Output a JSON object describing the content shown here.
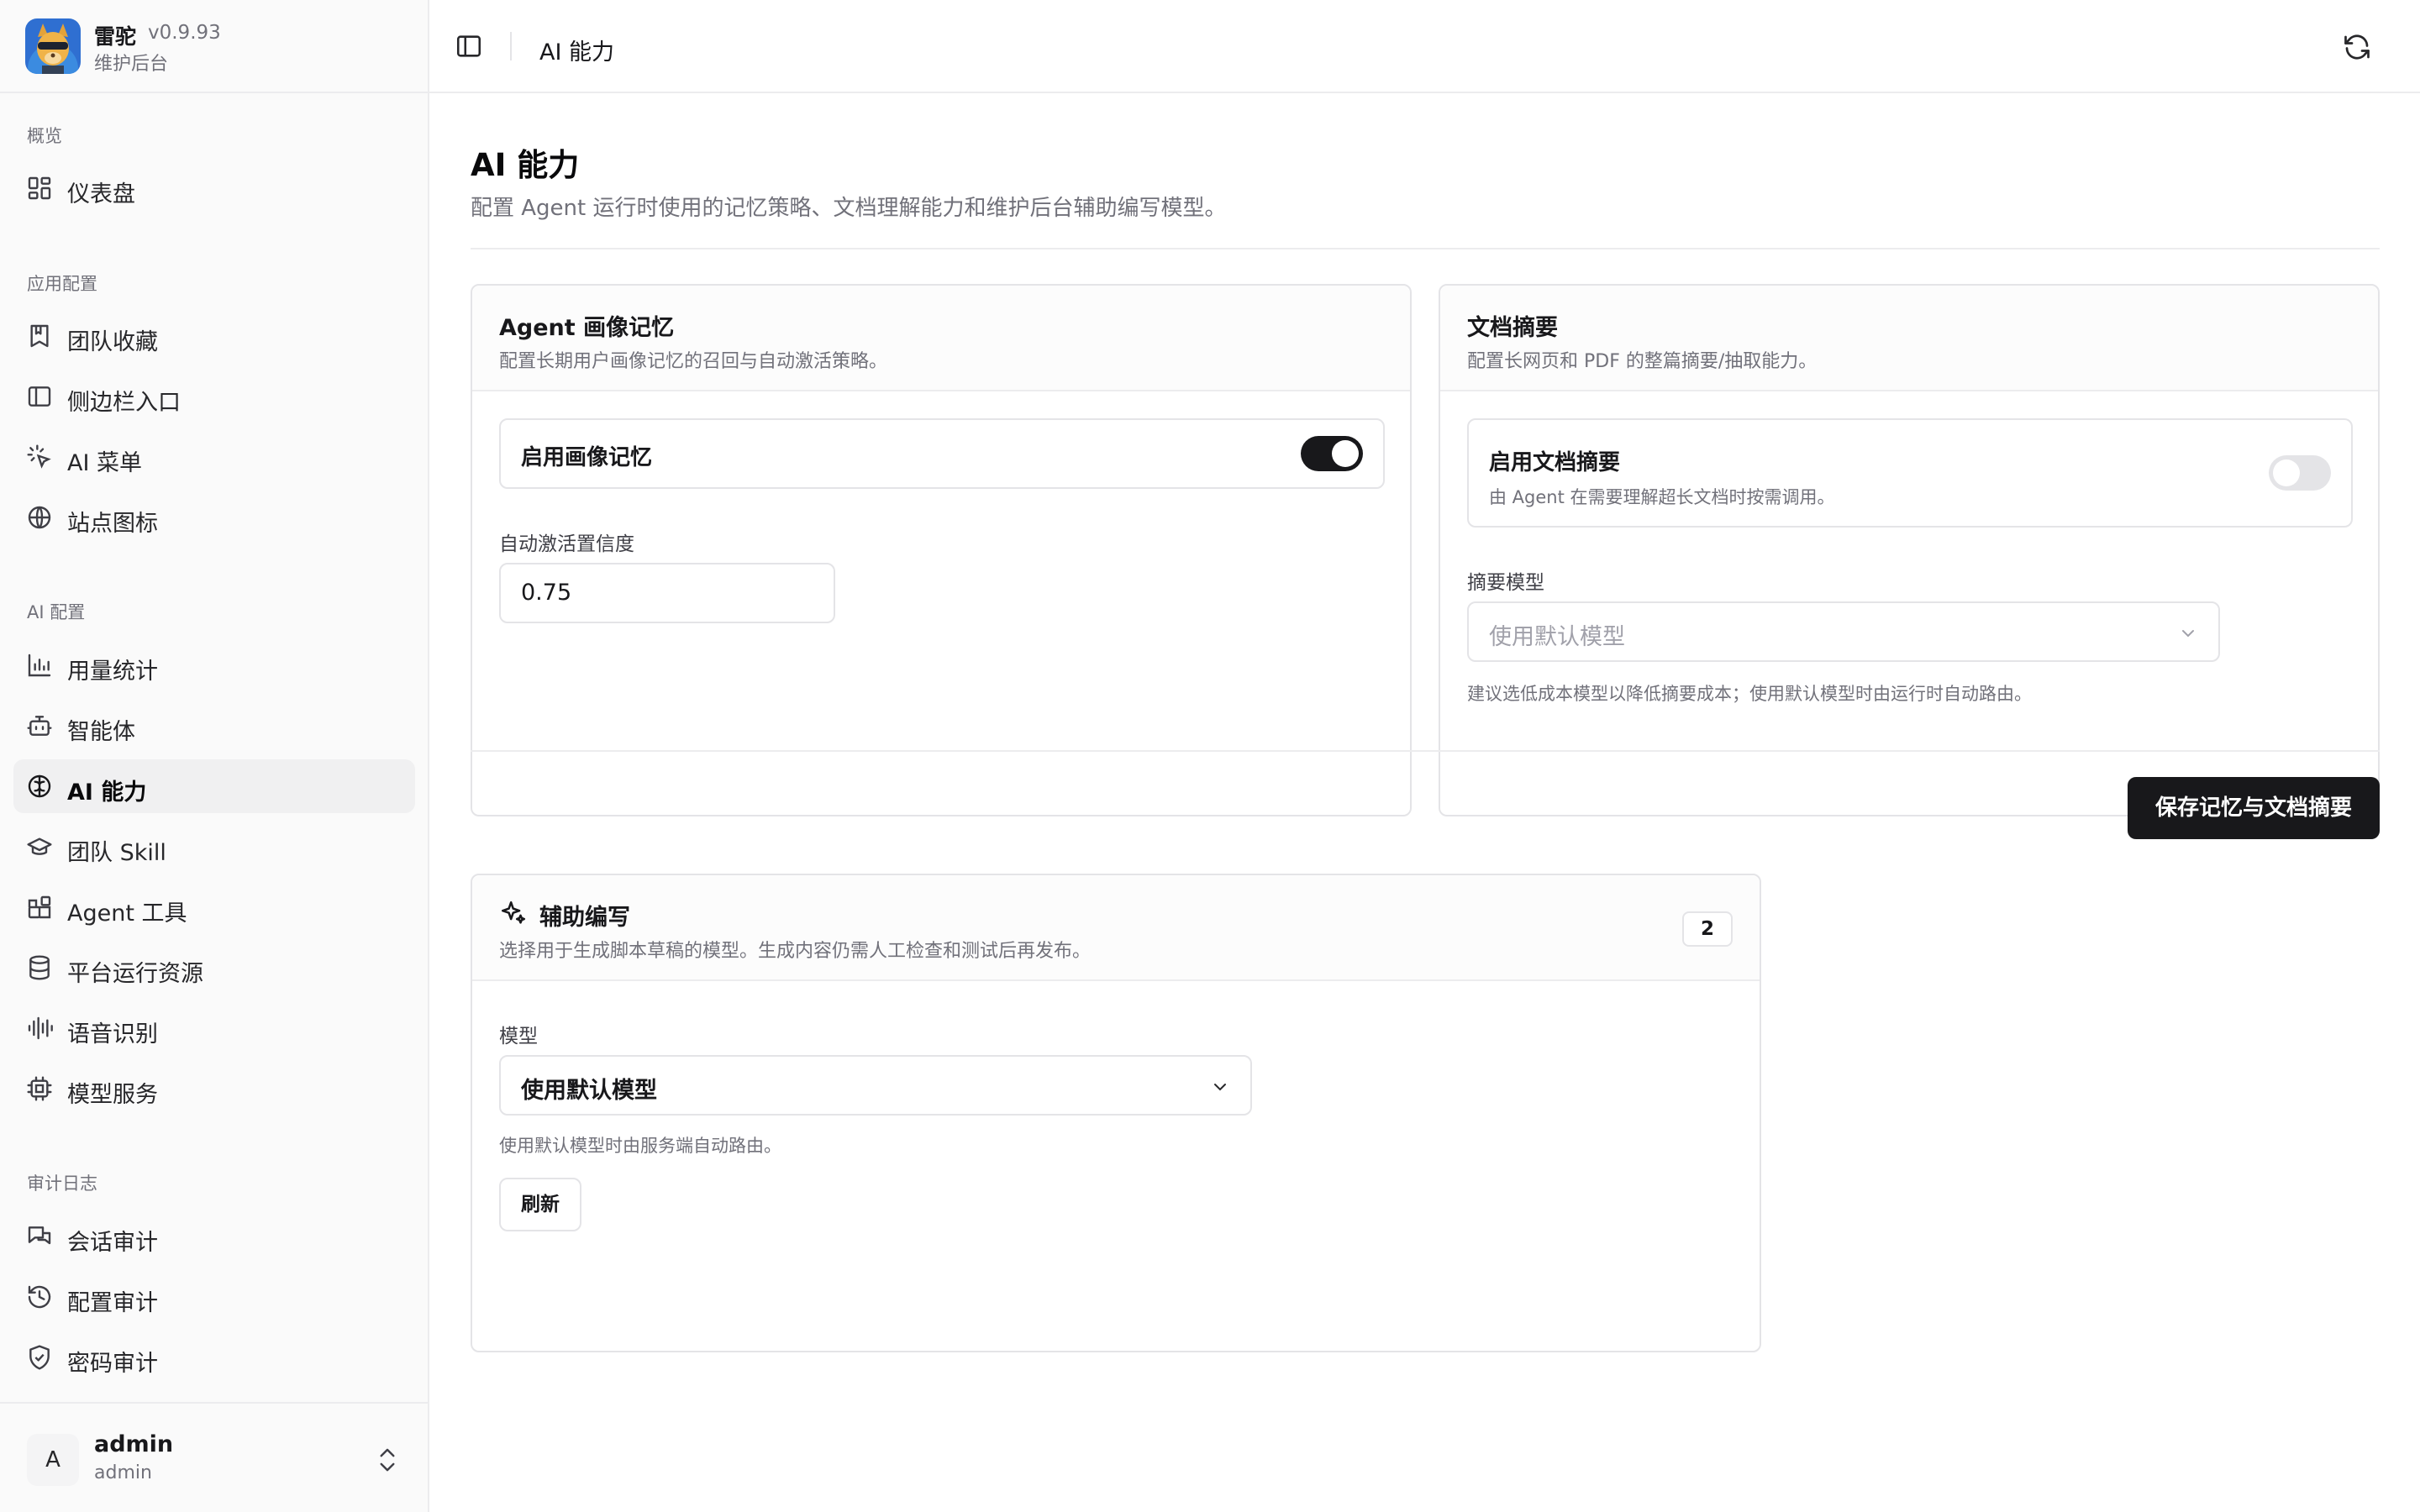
{
  "brand": {
    "name": "雷驼",
    "version": "v0.9.93",
    "subtitle": "维护后台"
  },
  "sidebar": {
    "sections": [
      {
        "title": "概览",
        "items": [
          {
            "label": "仪表盘",
            "icon": "dashboard-icon"
          }
        ]
      },
      {
        "title": "应用配置",
        "items": [
          {
            "label": "团队收藏",
            "icon": "bookmark-icon"
          },
          {
            "label": "侧边栏入口",
            "icon": "sidebar-panel-icon"
          },
          {
            "label": "AI 菜单",
            "icon": "sparkle-cursor-icon"
          },
          {
            "label": "站点图标",
            "icon": "globe-icon"
          }
        ]
      },
      {
        "title": "AI 配置",
        "items": [
          {
            "label": "用量统计",
            "icon": "bar-chart-icon"
          },
          {
            "label": "智能体",
            "icon": "bot-icon"
          },
          {
            "label": "AI 能力",
            "icon": "brain-icon",
            "active": true
          },
          {
            "label": "团队 Skill",
            "icon": "graduation-cap-icon"
          },
          {
            "label": "Agent 工具",
            "icon": "blocks-icon"
          },
          {
            "label": "平台运行资源",
            "icon": "database-icon"
          },
          {
            "label": "语音识别",
            "icon": "audio-lines-icon"
          },
          {
            "label": "模型服务",
            "icon": "cpu-icon"
          }
        ]
      },
      {
        "title": "审计日志",
        "items": [
          {
            "label": "会话审计",
            "icon": "messages-icon"
          },
          {
            "label": "配置审计",
            "icon": "history-icon"
          },
          {
            "label": "密码审计",
            "icon": "shield-check-icon"
          }
        ]
      }
    ]
  },
  "user": {
    "avatar_letter": "A",
    "name": "admin",
    "role": "admin"
  },
  "header": {
    "title": "AI 能力"
  },
  "page": {
    "title": "AI 能力",
    "description": "配置 Agent 运行时使用的记忆策略、文档理解能力和维护后台辅助编写模型。"
  },
  "memory_card": {
    "title": "Agent 画像记忆",
    "description": "配置长期用户画像记忆的召回与自动激活策略。",
    "toggle_label": "启用画像记忆",
    "toggle_on": true,
    "confidence_label": "自动激活置信度",
    "confidence_value": "0.75"
  },
  "summary_card": {
    "title": "文档摘要",
    "description": "配置长网页和 PDF 的整篇摘要/抽取能力。",
    "toggle_label": "启用文档摘要",
    "toggle_desc": "由 Agent 在需要理解超长文档时按需调用。",
    "toggle_on": false,
    "model_label": "摘要模型",
    "model_value": "使用默认模型",
    "model_hint": "建议选低成本模型以降低摘要成本；使用默认模型时由运行时自动路由。"
  },
  "save_button": "保存记忆与文档摘要",
  "assist_card": {
    "title": "辅助编写",
    "description": "选择用于生成脚本草稿的模型。生成内容仍需人工检查和测试后再发布。",
    "count": "2",
    "model_label": "模型",
    "model_value": "使用默认模型",
    "model_hint": "使用默认模型时由服务端自动路由。",
    "refresh_label": "刷新"
  },
  "colors": {
    "primary": "#18181b",
    "muted": "#71717a",
    "border": "#e4e4e7",
    "sidebar_bg": "#fafafa"
  }
}
